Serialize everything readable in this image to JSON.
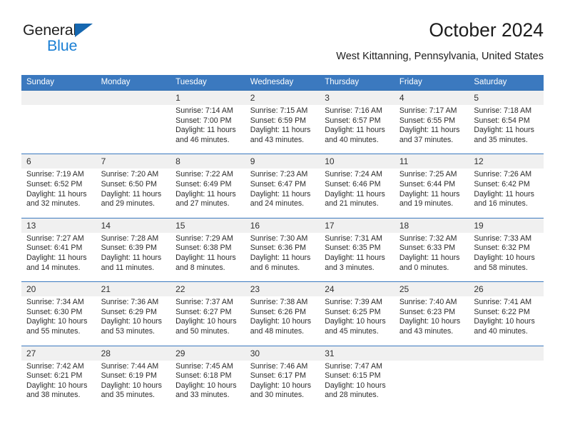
{
  "logo": {
    "line1": "General",
    "line2": "Blue",
    "triangle_color": "#1567b0",
    "line1_color": "#212121",
    "line2_color": "#1a7fd4"
  },
  "header": {
    "title": "October 2024",
    "subtitle": "West Kittanning, Pennsylvania, United States"
  },
  "colors": {
    "header_row_bg": "#3b79bf",
    "date_strip_bg": "#f0f0f0",
    "week_divider": "#3b79bf",
    "text": "#2b2b2b"
  },
  "calendar": {
    "weekday_headers": [
      "Sunday",
      "Monday",
      "Tuesday",
      "Wednesday",
      "Thursday",
      "Friday",
      "Saturday"
    ],
    "weeks": [
      [
        {
          "date": "",
          "sunrise": "",
          "sunset": "",
          "daylight_1": "",
          "daylight_2": ""
        },
        {
          "date": "",
          "sunrise": "",
          "sunset": "",
          "daylight_1": "",
          "daylight_2": ""
        },
        {
          "date": "1",
          "sunrise": "Sunrise: 7:14 AM",
          "sunset": "Sunset: 7:00 PM",
          "daylight_1": "Daylight: 11 hours",
          "daylight_2": "and 46 minutes."
        },
        {
          "date": "2",
          "sunrise": "Sunrise: 7:15 AM",
          "sunset": "Sunset: 6:59 PM",
          "daylight_1": "Daylight: 11 hours",
          "daylight_2": "and 43 minutes."
        },
        {
          "date": "3",
          "sunrise": "Sunrise: 7:16 AM",
          "sunset": "Sunset: 6:57 PM",
          "daylight_1": "Daylight: 11 hours",
          "daylight_2": "and 40 minutes."
        },
        {
          "date": "4",
          "sunrise": "Sunrise: 7:17 AM",
          "sunset": "Sunset: 6:55 PM",
          "daylight_1": "Daylight: 11 hours",
          "daylight_2": "and 37 minutes."
        },
        {
          "date": "5",
          "sunrise": "Sunrise: 7:18 AM",
          "sunset": "Sunset: 6:54 PM",
          "daylight_1": "Daylight: 11 hours",
          "daylight_2": "and 35 minutes."
        }
      ],
      [
        {
          "date": "6",
          "sunrise": "Sunrise: 7:19 AM",
          "sunset": "Sunset: 6:52 PM",
          "daylight_1": "Daylight: 11 hours",
          "daylight_2": "and 32 minutes."
        },
        {
          "date": "7",
          "sunrise": "Sunrise: 7:20 AM",
          "sunset": "Sunset: 6:50 PM",
          "daylight_1": "Daylight: 11 hours",
          "daylight_2": "and 29 minutes."
        },
        {
          "date": "8",
          "sunrise": "Sunrise: 7:22 AM",
          "sunset": "Sunset: 6:49 PM",
          "daylight_1": "Daylight: 11 hours",
          "daylight_2": "and 27 minutes."
        },
        {
          "date": "9",
          "sunrise": "Sunrise: 7:23 AM",
          "sunset": "Sunset: 6:47 PM",
          "daylight_1": "Daylight: 11 hours",
          "daylight_2": "and 24 minutes."
        },
        {
          "date": "10",
          "sunrise": "Sunrise: 7:24 AM",
          "sunset": "Sunset: 6:46 PM",
          "daylight_1": "Daylight: 11 hours",
          "daylight_2": "and 21 minutes."
        },
        {
          "date": "11",
          "sunrise": "Sunrise: 7:25 AM",
          "sunset": "Sunset: 6:44 PM",
          "daylight_1": "Daylight: 11 hours",
          "daylight_2": "and 19 minutes."
        },
        {
          "date": "12",
          "sunrise": "Sunrise: 7:26 AM",
          "sunset": "Sunset: 6:42 PM",
          "daylight_1": "Daylight: 11 hours",
          "daylight_2": "and 16 minutes."
        }
      ],
      [
        {
          "date": "13",
          "sunrise": "Sunrise: 7:27 AM",
          "sunset": "Sunset: 6:41 PM",
          "daylight_1": "Daylight: 11 hours",
          "daylight_2": "and 14 minutes."
        },
        {
          "date": "14",
          "sunrise": "Sunrise: 7:28 AM",
          "sunset": "Sunset: 6:39 PM",
          "daylight_1": "Daylight: 11 hours",
          "daylight_2": "and 11 minutes."
        },
        {
          "date": "15",
          "sunrise": "Sunrise: 7:29 AM",
          "sunset": "Sunset: 6:38 PM",
          "daylight_1": "Daylight: 11 hours",
          "daylight_2": "and 8 minutes."
        },
        {
          "date": "16",
          "sunrise": "Sunrise: 7:30 AM",
          "sunset": "Sunset: 6:36 PM",
          "daylight_1": "Daylight: 11 hours",
          "daylight_2": "and 6 minutes."
        },
        {
          "date": "17",
          "sunrise": "Sunrise: 7:31 AM",
          "sunset": "Sunset: 6:35 PM",
          "daylight_1": "Daylight: 11 hours",
          "daylight_2": "and 3 minutes."
        },
        {
          "date": "18",
          "sunrise": "Sunrise: 7:32 AM",
          "sunset": "Sunset: 6:33 PM",
          "daylight_1": "Daylight: 11 hours",
          "daylight_2": "and 0 minutes."
        },
        {
          "date": "19",
          "sunrise": "Sunrise: 7:33 AM",
          "sunset": "Sunset: 6:32 PM",
          "daylight_1": "Daylight: 10 hours",
          "daylight_2": "and 58 minutes."
        }
      ],
      [
        {
          "date": "20",
          "sunrise": "Sunrise: 7:34 AM",
          "sunset": "Sunset: 6:30 PM",
          "daylight_1": "Daylight: 10 hours",
          "daylight_2": "and 55 minutes."
        },
        {
          "date": "21",
          "sunrise": "Sunrise: 7:36 AM",
          "sunset": "Sunset: 6:29 PM",
          "daylight_1": "Daylight: 10 hours",
          "daylight_2": "and 53 minutes."
        },
        {
          "date": "22",
          "sunrise": "Sunrise: 7:37 AM",
          "sunset": "Sunset: 6:27 PM",
          "daylight_1": "Daylight: 10 hours",
          "daylight_2": "and 50 minutes."
        },
        {
          "date": "23",
          "sunrise": "Sunrise: 7:38 AM",
          "sunset": "Sunset: 6:26 PM",
          "daylight_1": "Daylight: 10 hours",
          "daylight_2": "and 48 minutes."
        },
        {
          "date": "24",
          "sunrise": "Sunrise: 7:39 AM",
          "sunset": "Sunset: 6:25 PM",
          "daylight_1": "Daylight: 10 hours",
          "daylight_2": "and 45 minutes."
        },
        {
          "date": "25",
          "sunrise": "Sunrise: 7:40 AM",
          "sunset": "Sunset: 6:23 PM",
          "daylight_1": "Daylight: 10 hours",
          "daylight_2": "and 43 minutes."
        },
        {
          "date": "26",
          "sunrise": "Sunrise: 7:41 AM",
          "sunset": "Sunset: 6:22 PM",
          "daylight_1": "Daylight: 10 hours",
          "daylight_2": "and 40 minutes."
        }
      ],
      [
        {
          "date": "27",
          "sunrise": "Sunrise: 7:42 AM",
          "sunset": "Sunset: 6:21 PM",
          "daylight_1": "Daylight: 10 hours",
          "daylight_2": "and 38 minutes."
        },
        {
          "date": "28",
          "sunrise": "Sunrise: 7:44 AM",
          "sunset": "Sunset: 6:19 PM",
          "daylight_1": "Daylight: 10 hours",
          "daylight_2": "and 35 minutes."
        },
        {
          "date": "29",
          "sunrise": "Sunrise: 7:45 AM",
          "sunset": "Sunset: 6:18 PM",
          "daylight_1": "Daylight: 10 hours",
          "daylight_2": "and 33 minutes."
        },
        {
          "date": "30",
          "sunrise": "Sunrise: 7:46 AM",
          "sunset": "Sunset: 6:17 PM",
          "daylight_1": "Daylight: 10 hours",
          "daylight_2": "and 30 minutes."
        },
        {
          "date": "31",
          "sunrise": "Sunrise: 7:47 AM",
          "sunset": "Sunset: 6:15 PM",
          "daylight_1": "Daylight: 10 hours",
          "daylight_2": "and 28 minutes."
        },
        {
          "date": "",
          "sunrise": "",
          "sunset": "",
          "daylight_1": "",
          "daylight_2": ""
        },
        {
          "date": "",
          "sunrise": "",
          "sunset": "",
          "daylight_1": "",
          "daylight_2": ""
        }
      ]
    ]
  }
}
